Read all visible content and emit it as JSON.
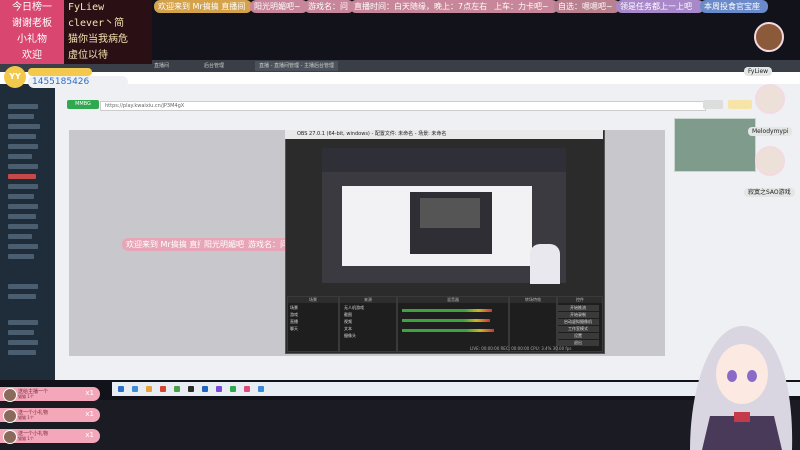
{
  "marquee": {
    "items": [
      {
        "text": "欢迎来到 Mr搞搞 直播间",
        "color": "#d4a24a"
      },
      {
        "text": "阳光明媚吧~",
        "color": "#c7869a"
      },
      {
        "text": "游戏名：问",
        "color": "#c7869a"
      },
      {
        "text": "直播时间：白天随缘，晚上：7点左右",
        "color": "#c7869a"
      },
      {
        "text": "上车：力卡吧~",
        "color": "#c7869a"
      },
      {
        "text": "自选：嗯嗯吧~",
        "color": "#b9808f"
      },
      {
        "text": "领是任务都上一上吧",
        "color": "#a888c9"
      },
      {
        "text": "本周投食官宝座",
        "color": "#6a8ac9"
      }
    ]
  },
  "info_panel": {
    "rows": [
      {
        "label": "今日榜一",
        "value": "FyLiew"
      },
      {
        "label": "谢谢老板",
        "value": "clever丶简"
      },
      {
        "label": "小礼物",
        "value": "猫你当我病危"
      },
      {
        "label": "欢迎",
        "value": "虚位以待"
      }
    ],
    "user_tag": "YY",
    "user_id": "1455185426"
  },
  "browser": {
    "tabs": [
      "直播间",
      "后台管理",
      "直播 - 直播间管理 - 主播后台管理"
    ],
    "url": "https://play.kwaixiu.cn/jP3M4gX",
    "green_button": "MMBG",
    "overlay_pills": [
      "欢迎来到 Mr搞搞 直播间",
      "阳光明媚吧~",
      "游戏名：问"
    ]
  },
  "obs": {
    "title": "OBS 27.0.1 (64-bit, windows) - 配置文件: 未命名 - 场景: 未命名",
    "docks": [
      {
        "header": "场景"
      },
      {
        "header": "来源"
      },
      {
        "header": "混音器"
      },
      {
        "header": "转场特效"
      },
      {
        "header": "控件"
      }
    ],
    "scenes": [
      "场景",
      "游戏",
      "直播",
      "聊天"
    ],
    "sources": [
      "无人机游戏",
      "截图",
      "视频",
      "文本",
      "摄像头"
    ],
    "controls": [
      "开始推流",
      "开始录制",
      "启动虚拟摄像机",
      "工作室模式",
      "设置",
      "退出"
    ],
    "status": "LIVE: 00:00:00  REC: 00:00:00  CPU: 3.4%  30.00 fps"
  },
  "gifts": [
    {
      "name": "送给主播一个",
      "sub": "猫猫 1个",
      "count": "x1"
    },
    {
      "name": "送一个小礼物",
      "sub": "猫猫 1个",
      "count": "x1"
    },
    {
      "name": "送一个小礼物",
      "sub": "猫猫 1个",
      "count": "x1"
    }
  ],
  "viewers": [
    {
      "name": "FyLiew"
    },
    {
      "name": "Melodymypi"
    },
    {
      "name": "寂寞之SAO游戏"
    }
  ],
  "colors": {
    "accent": "#d9466f",
    "info_bg": "#2a0f15",
    "info_value": "#f3e7b0",
    "gift_bg": "#f4a7b9"
  }
}
